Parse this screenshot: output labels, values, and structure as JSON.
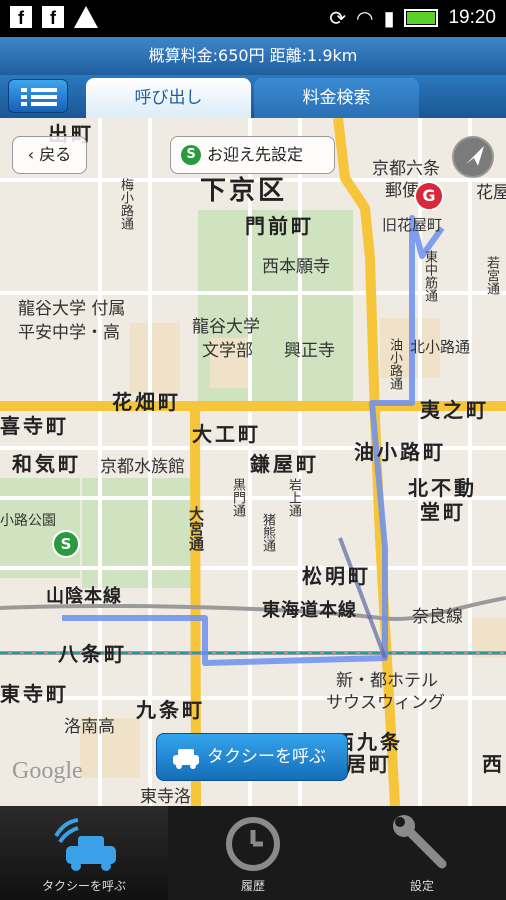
{
  "status_bar": {
    "time": "19:20",
    "notification_label_1": "f",
    "notification_label_2": "f"
  },
  "info_bar": {
    "text": "概算料金:650円 距離:1.9km"
  },
  "tabs": [
    {
      "label": "呼び出し"
    },
    {
      "label": "料金検索"
    }
  ],
  "map": {
    "back_label": "戻る",
    "pickup_label": "お迎え先設定",
    "pickup_badge": "S",
    "marker_start": "S",
    "marker_goal": "G",
    "call_taxi_label": "タクシーを呼ぶ",
    "google_watermark": "Google",
    "labels": {
      "top_left": "出町",
      "shimogyo": "下京区",
      "monzen": "門前町",
      "nishihonganji": "西本願寺",
      "ryukoku_fuzoku": "龍谷大学 付属",
      "heian": "平安中学・高",
      "ryukoku_bungakubu": "龍谷大学",
      "bungakubu": "文学部",
      "koshoji": "興正寺",
      "hanabata": "花畑町",
      "kijimachi": "喜寺町",
      "wakemachi": "和気町",
      "suizokukan": "京都水族館",
      "daiku": "大工町",
      "kamaya": "鎌屋町",
      "aburakoji_cho": "油小路町",
      "kitafudo": "北不動",
      "dou": "堂町",
      "ebisunocho": "夷之町",
      "kyoto_rokujo": "京都六条",
      "yubinkyoku": "郵便局",
      "kyu_hanaya": "旧花屋町",
      "hanaya": "花屋",
      "kita_koji": "北小路通",
      "matsuake": "松明町",
      "tokaido": "東海道本線",
      "sanin": "山陰本線",
      "nara": "奈良線",
      "hachijo": "八条町",
      "toji": "東寺町",
      "kujo": "九条町",
      "shin_miyako": "新・都ホテル",
      "south_wing": "サウスウィング",
      "nishi_kujo": "西九条",
      "kyoto_koen": "小路公園",
      "rakunan": "洛南高",
      "toji_raku": "東寺洛",
      "nishi_short": "西",
      "kita": "町",
      "kyoto_jiho": "京",
      "umekoji_street": "梅小路通",
      "omiya": "大宮通",
      "kurogami": "黒門通",
      "iwagami": "岩上通",
      "inokuma": "猪熊通",
      "higashi_nakasuji": "東中筋通",
      "aburakoji": "油小路通",
      "nishinotoin": "若宮通",
      "kuro_ji": "居町"
    }
  },
  "bottom_nav": [
    {
      "label": "タクシーを呼ぶ"
    },
    {
      "label": "履歴"
    },
    {
      "label": "設定"
    }
  ],
  "colors": {
    "route": "#6c8ff0",
    "main_road": "#f6c53a",
    "park": "#cfe3c1",
    "accent": "#1f6fc0"
  }
}
